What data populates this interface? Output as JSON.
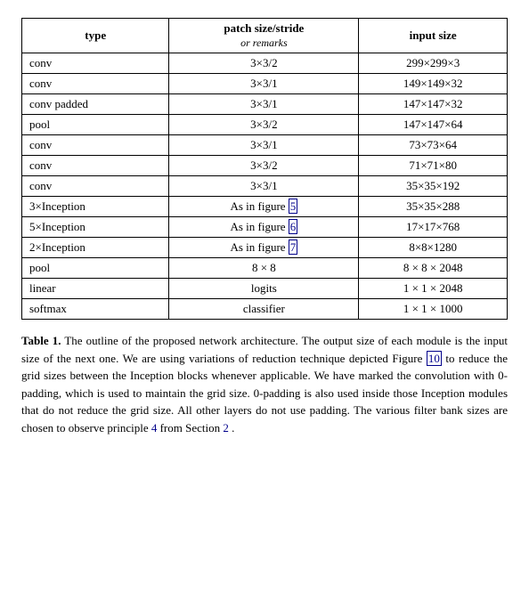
{
  "table": {
    "headers": [
      {
        "label": "type",
        "sub": ""
      },
      {
        "label": "patch size/stride",
        "sub": "or remarks"
      },
      {
        "label": "input size",
        "sub": ""
      }
    ],
    "rows": [
      {
        "type": "conv",
        "patch": "3×3/2",
        "input": "299×299×3"
      },
      {
        "type": "conv",
        "patch": "3×3/1",
        "input": "149×149×32"
      },
      {
        "type": "conv padded",
        "patch": "3×3/1",
        "input": "147×147×32"
      },
      {
        "type": "pool",
        "patch": "3×3/2",
        "input": "147×147×64"
      },
      {
        "type": "conv",
        "patch": "3×3/1",
        "input": "73×73×64"
      },
      {
        "type": "conv",
        "patch": "3×3/2",
        "input": "71×71×80"
      },
      {
        "type": "conv",
        "patch": "3×3/1",
        "input": "35×35×192"
      },
      {
        "type": "3×Inception",
        "patch": "As in figure 5",
        "patch_link": "5",
        "patch_link_box": true,
        "input": "35×35×288"
      },
      {
        "type": "5×Inception",
        "patch": "As in figure 6",
        "patch_link": "6",
        "patch_link_box": true,
        "input": "17×17×768"
      },
      {
        "type": "2×Inception",
        "patch": "As in figure 7",
        "patch_link": "7",
        "patch_link_box": true,
        "input": "8×8×1280"
      },
      {
        "type": "pool",
        "patch": "8 × 8",
        "input": "8 × 8 × 2048"
      },
      {
        "type": "linear",
        "patch": "logits",
        "input": "1 × 1 × 2048"
      },
      {
        "type": "softmax",
        "patch": "classifier",
        "input": "1 × 1 × 1000"
      }
    ]
  },
  "caption": {
    "label": "Table 1.",
    "text": " The outline of the proposed network architecture.  The output size of each module is the input size of the next one.  We are using variations of reduction technique depicted Figure ",
    "link1": "10",
    "text2": " to reduce the grid sizes between the Inception blocks whenever applicable.  We have marked the convolution with 0-padding, which is used to maintain the grid size.  0-padding is also used inside those Inception modules that do not reduce the grid size.  All other layers do not use padding.  The various filter bank sizes are chosen to observe principle ",
    "link2": "4",
    "text3": " from Section ",
    "link3": "2",
    "text4": "."
  }
}
